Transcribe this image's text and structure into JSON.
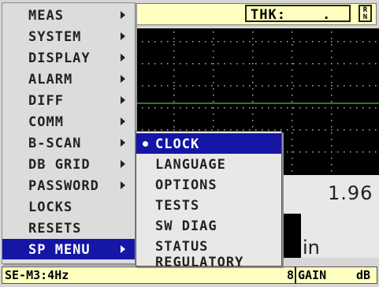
{
  "main_menu": {
    "items": [
      {
        "label": "MEAS",
        "has_submenu": true
      },
      {
        "label": "SYSTEM",
        "has_submenu": true
      },
      {
        "label": "DISPLAY",
        "has_submenu": true
      },
      {
        "label": "ALARM",
        "has_submenu": true
      },
      {
        "label": "DIFF",
        "has_submenu": true
      },
      {
        "label": "COMM",
        "has_submenu": true
      },
      {
        "label": "B-SCAN",
        "has_submenu": true
      },
      {
        "label": "DB GRID",
        "has_submenu": true
      },
      {
        "label": "PASSWORD",
        "has_submenu": true
      },
      {
        "label": "LOCKS",
        "has_submenu": false
      },
      {
        "label": "RESETS",
        "has_submenu": false
      },
      {
        "label": "SP MENU",
        "has_submenu": true,
        "selected": true
      }
    ]
  },
  "sp_submenu": {
    "items": [
      {
        "label": "CLOCK",
        "selected": true
      },
      {
        "label": "LANGUAGE"
      },
      {
        "label": "OPTIONS"
      },
      {
        "label": "TESTS"
      },
      {
        "label": "SW DIAG"
      },
      {
        "label": "STATUS"
      },
      {
        "label": "REGULATORY"
      }
    ]
  },
  "readout": {
    "thk_label": "THK:",
    "thk_value": ".",
    "rn_indicator": "R N",
    "main_value": "1.96",
    "unit": "in"
  },
  "status_bar": {
    "left_text": "SE-M3:4Hz",
    "fragment": "8",
    "gain_label": "GAIN",
    "gain_unit": "dB"
  },
  "colors": {
    "selection": "#1515a6",
    "menu_bg": "#dcdcdc",
    "screen_bg": "#000000",
    "gate_line": "#2fa82f",
    "grid_dots": "#b0b0b0",
    "field_bg": "#ffffc0"
  },
  "icons": {
    "submenu_arrow": "triangle-right-icon",
    "selected_bullet": "bullet-icon"
  }
}
